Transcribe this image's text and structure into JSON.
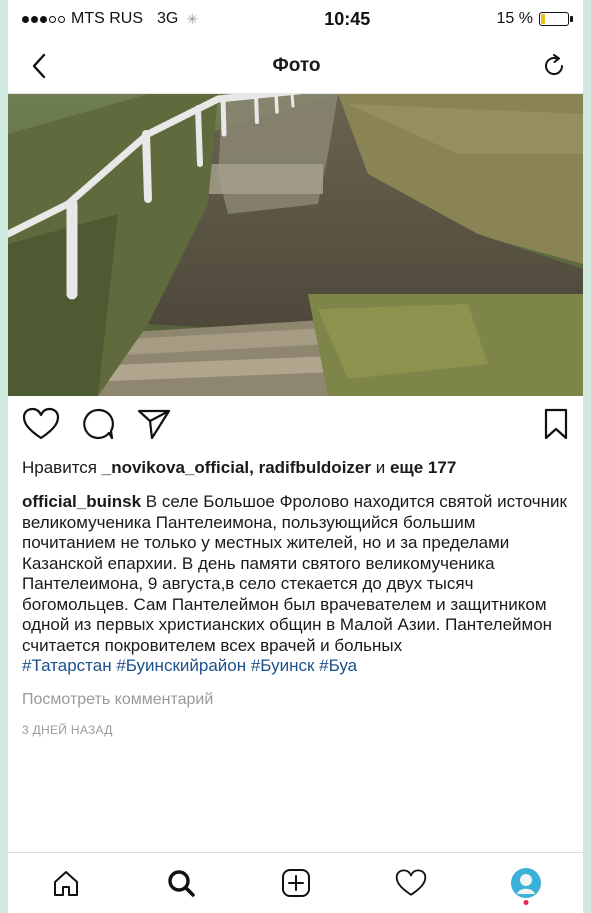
{
  "status_bar": {
    "carrier": "MTS RUS",
    "network": "3G",
    "time": "10:45",
    "battery_text": "15 %",
    "battery_level": 0.15
  },
  "nav": {
    "title": "Фото"
  },
  "post": {
    "likes_prefix": "Нравится ",
    "likes_user1": "_novikova_official",
    "likes_sep": ", ",
    "likes_user2": "radifbuldoizer",
    "likes_and": " и ",
    "likes_more": "еще 177",
    "caption_user": "official_buinsk",
    "caption_text": " В селе Большое Фролово находится святой источник великомученика Пантелеимона, пользующийся большим почитанием не только у местных жителей, но и за пределами Казанской епархии. В день памяти святого великомученика Пантелеимона, 9 августа,в село стекается до двух тысяч богомольцев.  Сам Пантелеймон был врачевателем и защитником одной из первых христианских общин в Малой Азии. Пантелеймон считается покровителем всех врачей и больных",
    "hashtags": "#Татарстан #Буинскийрайон #Буинск #Буа",
    "comments_link": "Посмотреть комментарий",
    "time_ago": "3 ДНЕЙ НАЗАД"
  },
  "icons": {
    "back": "chevron-left-icon",
    "refresh": "refresh-icon",
    "like": "heart-icon",
    "comment": "comment-icon",
    "share": "send-icon",
    "save": "bookmark-icon",
    "home": "home-icon",
    "search": "search-icon",
    "add": "add-icon",
    "activity": "heart-icon",
    "profile": "avatar"
  }
}
